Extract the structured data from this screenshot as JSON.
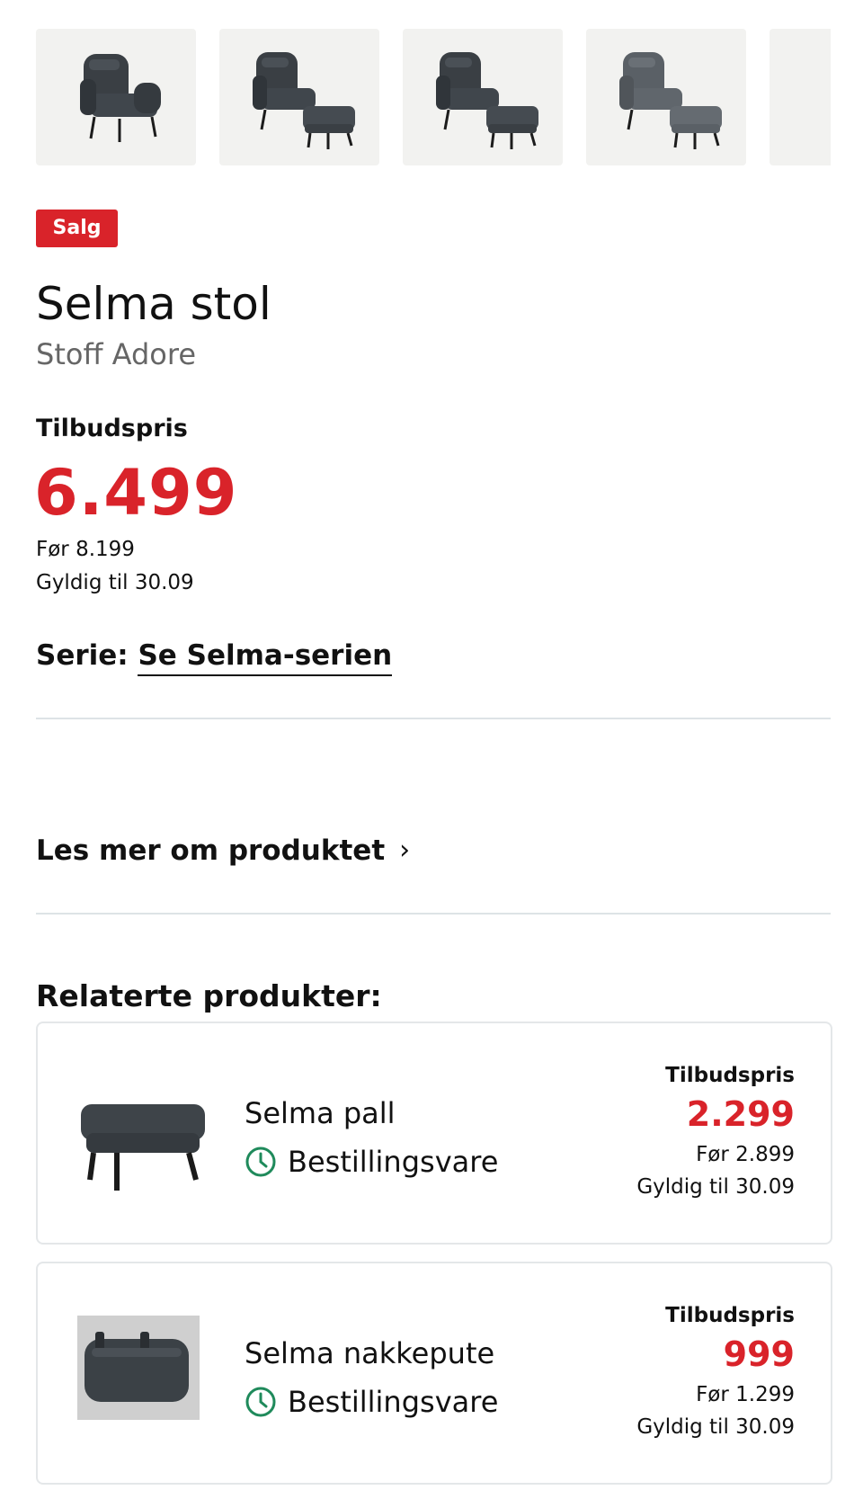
{
  "gallery": {
    "thumbnails": [
      {
        "icon": "armchair-image"
      },
      {
        "icon": "armchair-with-footstool-image"
      },
      {
        "icon": "armchair-with-footstool-image"
      },
      {
        "icon": "armchair-with-footstool-image"
      }
    ]
  },
  "product": {
    "badge": "Salg",
    "title": "Selma stol",
    "subtitle": "Stoff Adore",
    "offer_label": "Tilbudspris",
    "price": "6.499",
    "before_price": "Før 8.199",
    "valid_until": "Gyldig til 30.09",
    "series_label": "Serie:",
    "series_link": "Se Selma-serien"
  },
  "read_more": {
    "label": "Les mer om produktet",
    "icon": "chevron-right-icon"
  },
  "related": {
    "title": "Relaterte produkter:",
    "items": [
      {
        "name": "Selma pall",
        "stock": "Bestillingsvare",
        "offer_label": "Tilbudspris",
        "price": "2.299",
        "before_price": "Før 2.899",
        "valid_until": "Gyldig til 30.09",
        "icon": "footstool-image"
      },
      {
        "name": "Selma nakkepute",
        "stock": "Bestillingsvare",
        "offer_label": "Tilbudspris",
        "price": "999",
        "before_price": "Før 1.299",
        "valid_until": "Gyldig til 30.09",
        "icon": "neck-pillow-image"
      }
    ]
  },
  "colors": {
    "accent_red": "#d9232a",
    "stock_green": "#1f8a5b",
    "divider": "#dde3e6"
  }
}
